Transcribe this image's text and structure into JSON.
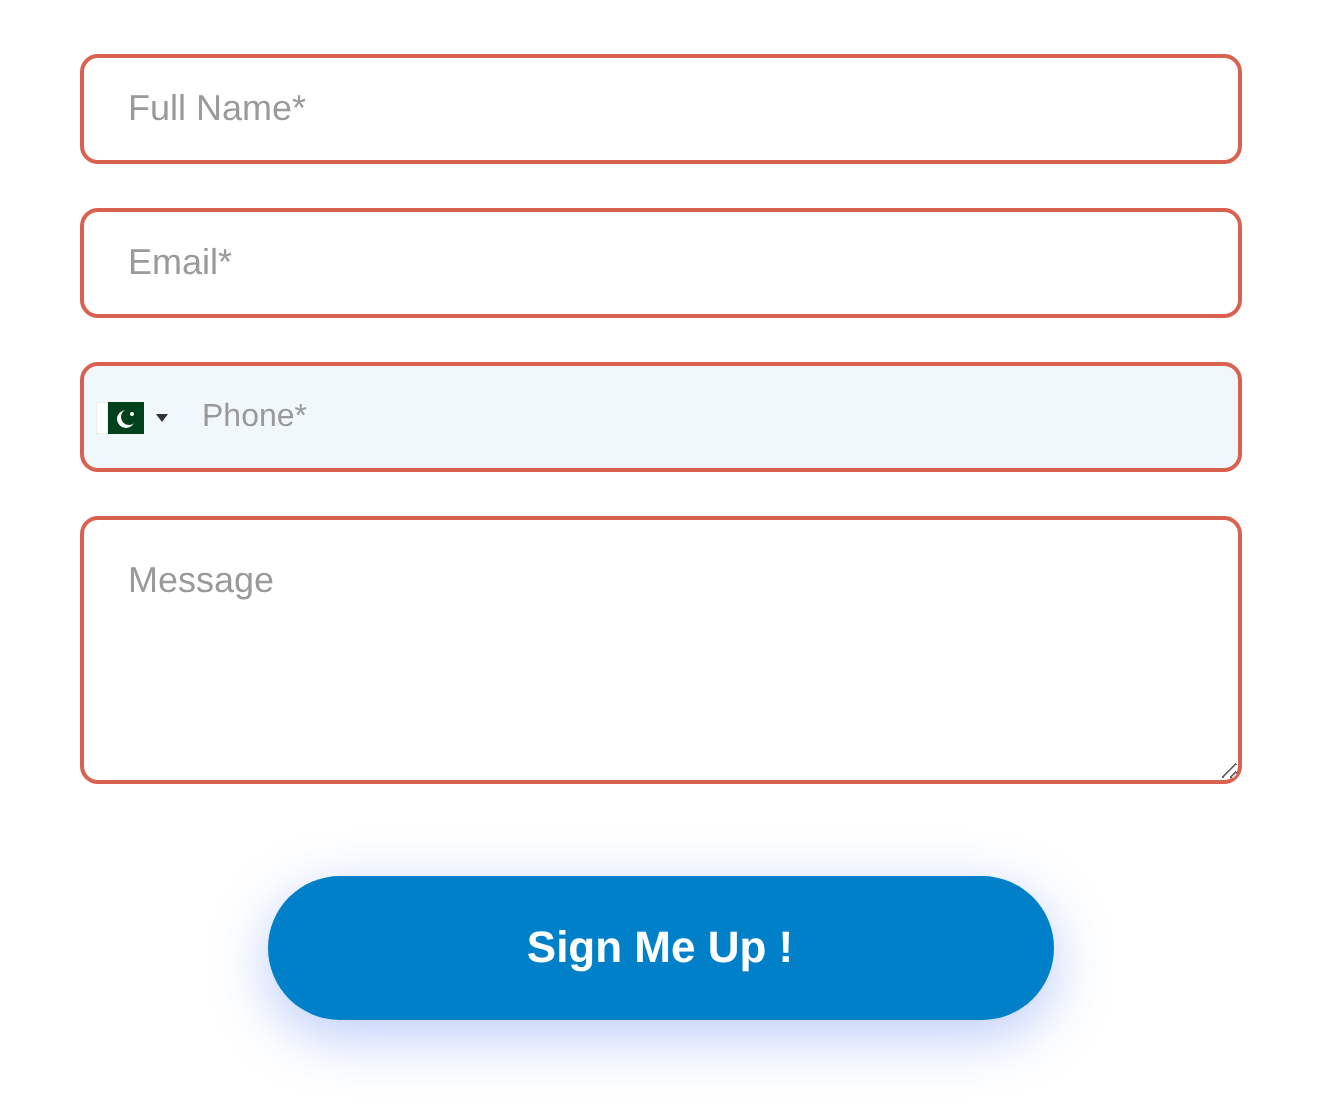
{
  "fields": [
    {
      "kind": "text",
      "placeholder": "Full Name*"
    },
    {
      "kind": "text",
      "placeholder": "Email*"
    },
    {
      "kind": "phone",
      "placeholder": "Phone*"
    },
    {
      "kind": "textarea",
      "placeholder": "Message"
    }
  ],
  "submit": {
    "label": "Sign Me Up !"
  }
}
